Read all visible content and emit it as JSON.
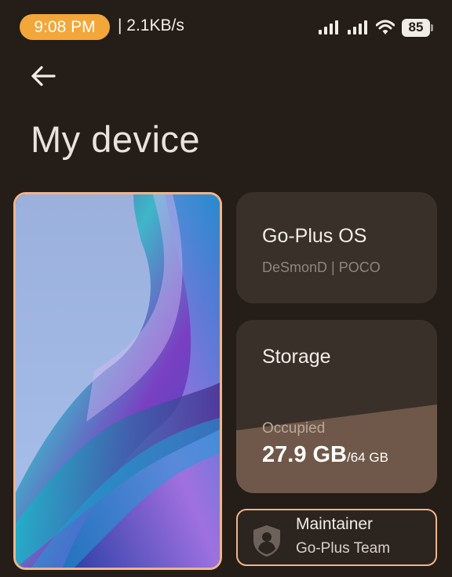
{
  "status_bar": {
    "time": "9:08 PM",
    "net_speed": "| 2.1KB/s",
    "battery": "85",
    "icons": [
      "signal-icon",
      "signal-icon",
      "wifi-icon",
      "battery-icon"
    ]
  },
  "header": {
    "back_icon": "arrow-left-icon",
    "title": "My device"
  },
  "os_card": {
    "name": "Go-Plus OS",
    "subtitle": "DeSmonD | POCO"
  },
  "storage": {
    "title": "Storage",
    "occupied_label": "Occupied",
    "used": "27.9 GB",
    "total": "/64 GB",
    "fill_color": "#6f5849"
  },
  "maintainer": {
    "icon": "shield-user-icon",
    "title": "Maintainer",
    "team": "Go-Plus Team"
  },
  "colors": {
    "background": "#241d18",
    "card": "#3a302a",
    "accent": "#f0b48a",
    "time_pill": "#f3a73a"
  }
}
